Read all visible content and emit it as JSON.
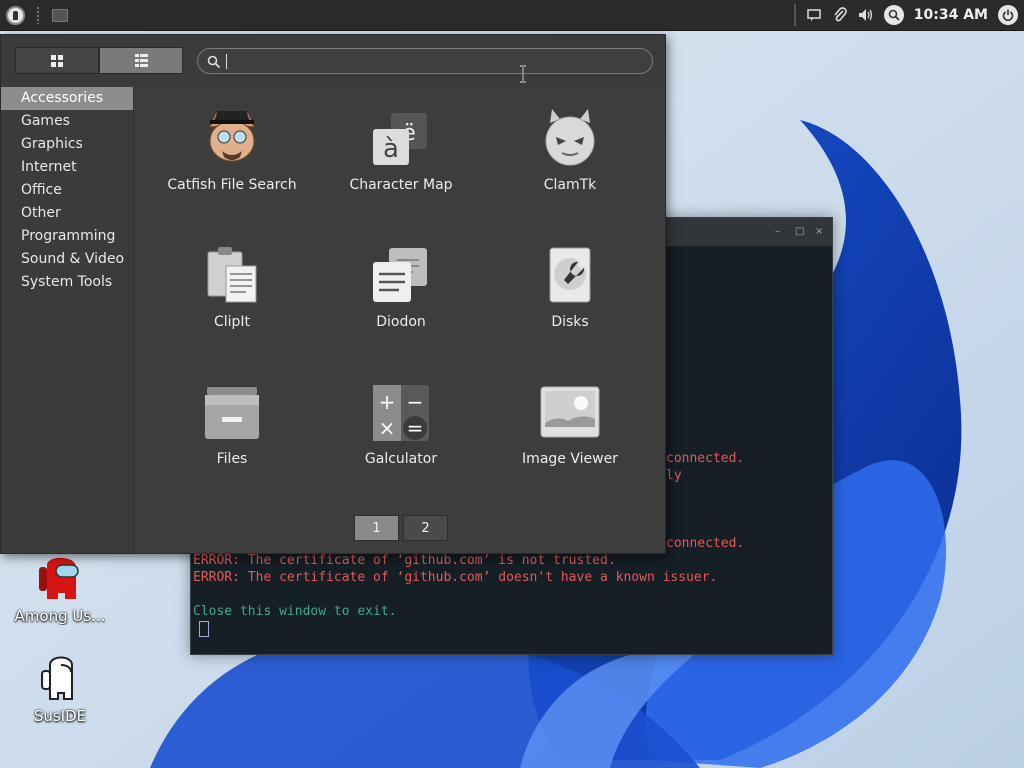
{
  "panel": {
    "clock": "10:34 AM"
  },
  "terminal": {
    "lines": [
      {
        "text": "connected.",
        "type": "err"
      },
      {
        "text": "ly",
        "type": "err"
      },
      {
        "text": "connected.",
        "type": "err"
      },
      {
        "text": "ERROR: The certificate of ‘github.com’ is not trusted.",
        "type": "err"
      },
      {
        "text": "ERROR: The certificate of ‘github.com’ doesn't have a known issuer.",
        "type": "err"
      },
      {
        "text": "Close this window to exit.",
        "type": "ok"
      }
    ]
  },
  "desktop": {
    "icons": [
      {
        "label": "Among Us..."
      },
      {
        "label": "SusIDE"
      }
    ]
  },
  "app_menu": {
    "search": {
      "value": "",
      "placeholder": ""
    },
    "categories": [
      "Accessories",
      "Games",
      "Graphics",
      "Internet",
      "Office",
      "Other",
      "Programming",
      "Sound & Video",
      "System Tools"
    ],
    "selected_category": "Accessories",
    "apps": [
      {
        "name": "Catfish File Search",
        "icon": "catfish-icon"
      },
      {
        "name": "Character Map",
        "icon": "character-map-icon"
      },
      {
        "name": "ClamTk",
        "icon": "clamtk-icon"
      },
      {
        "name": "ClipIt",
        "icon": "clipit-icon"
      },
      {
        "name": "Diodon",
        "icon": "diodon-icon"
      },
      {
        "name": "Disks",
        "icon": "disks-icon"
      },
      {
        "name": "Files",
        "icon": "files-icon"
      },
      {
        "name": "Galculator",
        "icon": "galculator-icon"
      },
      {
        "name": "Image Viewer",
        "icon": "image-viewer-icon"
      }
    ],
    "pages": [
      "1",
      "2"
    ],
    "current_page": "1",
    "char_map_glyphs": {
      "top": "ë",
      "bottom": "à"
    },
    "calc_glyphs": {
      "plus": "+",
      "minus": "−",
      "times": "×",
      "equals": "="
    }
  },
  "colors": {
    "menu_bg": "#3b3b3b",
    "selected_category": "#8d8d8d",
    "panel_bg": "#2b2b2b",
    "error_text": "#e05a5a",
    "info_text": "#3fa88f"
  }
}
